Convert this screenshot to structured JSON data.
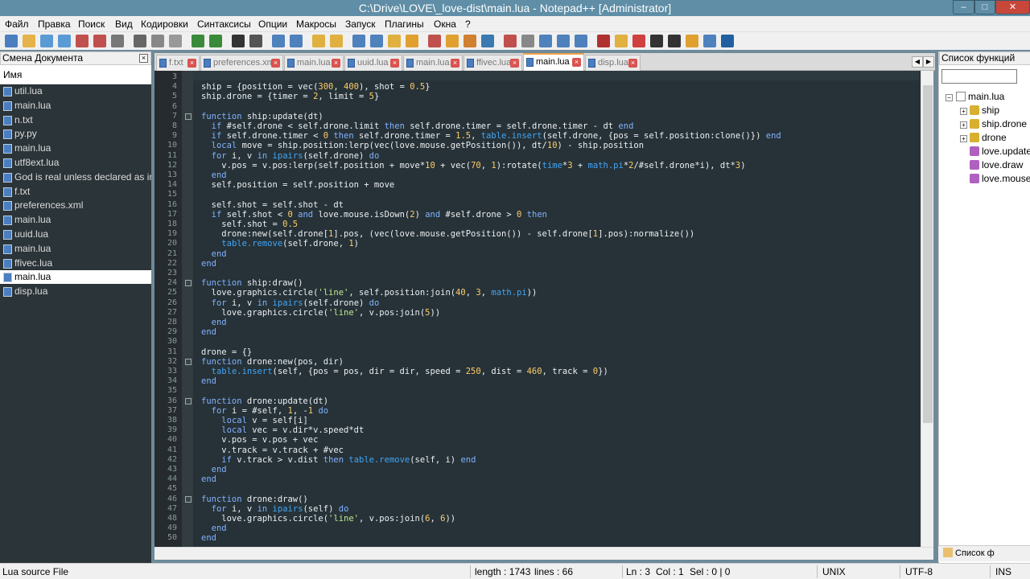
{
  "window": {
    "title": "C:\\Drive\\LOVE\\_love-dist\\main.lua - Notepad++ [Administrator]",
    "controls": {
      "minimize": "–",
      "maximize": "□",
      "close": "✕"
    }
  },
  "menu": [
    "Файл",
    "Правка",
    "Поиск",
    "Вид",
    "Кодировки",
    "Синтаксисы",
    "Опции",
    "Макросы",
    "Запуск",
    "Плагины",
    "Окна",
    "?"
  ],
  "toolbar_icons": [
    "new-file-icon",
    "open-file-icon",
    "save-icon",
    "save-all-icon",
    "close-icon",
    "close-all-icon",
    "print-icon",
    "cut-icon",
    "copy-icon",
    "paste-icon",
    "undo-icon",
    "redo-icon",
    "find-icon",
    "replace-icon",
    "zoom-in-icon",
    "zoom-out-icon",
    "sync-v-icon",
    "sync-h-icon",
    "word-wrap-icon",
    "show-all-chars-icon",
    "indent-guide-icon",
    "language-icon",
    "doc-map-icon",
    "function-list-icon",
    "folder-icon",
    "monitor-icon",
    "record-macro-icon",
    "stop-macro-icon",
    "play-macro-icon",
    "run-macro-icon",
    "save-macro-icon",
    "spellcheck-icon",
    "spell-icon",
    "heart-icon",
    "html-tag-icon",
    "text-icon",
    "explorer-icon",
    "refresh-icon",
    "globe-icon"
  ],
  "tabs": [
    {
      "label": "f.txt",
      "active": false
    },
    {
      "label": "preferences.xml",
      "active": false
    },
    {
      "label": "main.lua",
      "active": false
    },
    {
      "label": "uuid.lua",
      "active": false
    },
    {
      "label": "main.lua",
      "active": false
    },
    {
      "label": "ffivec.lua",
      "active": false
    },
    {
      "label": "main.lua",
      "active": true
    },
    {
      "label": "disp.lua",
      "active": false
    }
  ],
  "doc_switcher": {
    "title": "Смена Документа",
    "column": "Имя",
    "items": [
      "util.lua",
      "main.lua",
      "n.txt",
      "py.py",
      "main.lua",
      "utf8ext.lua",
      "God is real unless declared as int...",
      "f.txt",
      "preferences.xml",
      "main.lua",
      "uuid.lua",
      "main.lua",
      "ffivec.lua",
      "main.lua",
      "disp.lua"
    ],
    "selected_index": 13
  },
  "editor": {
    "lines": [
      {
        "n": "3",
        "text": ""
      },
      {
        "n": "4",
        "text": "ship = {position = vec(300, 400), shot = 0.5}"
      },
      {
        "n": "5",
        "text": "ship.drone = {timer = 2, limit = 5}"
      },
      {
        "n": "6",
        "text": ""
      },
      {
        "n": "7",
        "text": "function ship:update(dt)"
      },
      {
        "n": "8",
        "text": "  if #self.drone < self.drone.limit then self.drone.timer = self.drone.timer - dt end"
      },
      {
        "n": "9",
        "text": "  if self.drone.timer < 0 then self.drone.timer = 1.5, table.insert(self.drone, {pos = self.position:clone()}) end"
      },
      {
        "n": "10",
        "text": "  local move = ship.position:lerp(vec(love.mouse.getPosition()), dt/10) - ship.position"
      },
      {
        "n": "11",
        "text": "  for i, v in ipairs(self.drone) do"
      },
      {
        "n": "12",
        "text": "    v.pos = v.pos:lerp(self.position + move*10 + vec(70, 1):rotate(time*3 + math.pi*2/#self.drone*i), dt*3)"
      },
      {
        "n": "13",
        "text": "  end"
      },
      {
        "n": "14",
        "text": "  self.position = self.position + move"
      },
      {
        "n": "15",
        "text": ""
      },
      {
        "n": "16",
        "text": "  self.shot = self.shot - dt"
      },
      {
        "n": "17",
        "text": "  if self.shot < 0 and love.mouse.isDown(2) and #self.drone > 0 then"
      },
      {
        "n": "18",
        "text": "    self.shot = 0.5"
      },
      {
        "n": "19",
        "text": "    drone:new(self.drone[1].pos, (vec(love.mouse.getPosition()) - self.drone[1].pos):normalize())"
      },
      {
        "n": "20",
        "text": "    table.remove(self.drone, 1)"
      },
      {
        "n": "21",
        "text": "  end"
      },
      {
        "n": "22",
        "text": "end"
      },
      {
        "n": "23",
        "text": ""
      },
      {
        "n": "24",
        "text": "function ship:draw()"
      },
      {
        "n": "25",
        "text": "  love.graphics.circle('line', self.position:join(40, 3, math.pi))"
      },
      {
        "n": "26",
        "text": "  for i, v in ipairs(self.drone) do"
      },
      {
        "n": "27",
        "text": "    love.graphics.circle('line', v.pos:join(5))"
      },
      {
        "n": "28",
        "text": "  end"
      },
      {
        "n": "29",
        "text": "end"
      },
      {
        "n": "30",
        "text": ""
      },
      {
        "n": "31",
        "text": "drone = {}"
      },
      {
        "n": "32",
        "text": "function drone:new(pos, dir)"
      },
      {
        "n": "33",
        "text": "  table.insert(self, {pos = pos, dir = dir, speed = 250, dist = 460, track = 0})"
      },
      {
        "n": "34",
        "text": "end"
      },
      {
        "n": "35",
        "text": ""
      },
      {
        "n": "36",
        "text": "function drone:update(dt)"
      },
      {
        "n": "37",
        "text": "  for i = #self, 1, -1 do"
      },
      {
        "n": "38",
        "text": "    local v = self[i]"
      },
      {
        "n": "39",
        "text": "    local vec = v.dir*v.speed*dt"
      },
      {
        "n": "40",
        "text": "    v.pos = v.pos + vec"
      },
      {
        "n": "41",
        "text": "    v.track = v.track + #vec"
      },
      {
        "n": "42",
        "text": "    if v.track > v.dist then table.remove(self, i) end"
      },
      {
        "n": "43",
        "text": "  end"
      },
      {
        "n": "44",
        "text": "end"
      },
      {
        "n": "45",
        "text": ""
      },
      {
        "n": "46",
        "text": "function drone:draw()"
      },
      {
        "n": "47",
        "text": "  for i, v in ipairs(self) do"
      },
      {
        "n": "48",
        "text": "    love.graphics.circle('line', v.pos:join(6, 6))"
      },
      {
        "n": "49",
        "text": "  end"
      },
      {
        "n": "50",
        "text": "end"
      }
    ]
  },
  "function_list": {
    "title": "Список функций",
    "root": "main.lua",
    "items": [
      {
        "label": "ship",
        "kind": "class",
        "expandable": true
      },
      {
        "label": "ship.drone",
        "kind": "class",
        "expandable": true
      },
      {
        "label": "drone",
        "kind": "class",
        "expandable": true
      },
      {
        "label": "love.update",
        "kind": "function",
        "expandable": false
      },
      {
        "label": "love.draw",
        "kind": "function",
        "expandable": false
      },
      {
        "label": "love.mouse",
        "kind": "function",
        "expandable": false
      }
    ],
    "bottom_tab": "Список ф"
  },
  "status": {
    "filetype": "Lua source File",
    "length": "length : 1743",
    "lines": "lines : 66",
    "ln": "Ln : 3",
    "col": "Col : 1",
    "sel": "Sel : 0 | 0",
    "eol": "UNIX",
    "encoding": "UTF-8",
    "mode": "INS"
  },
  "colors": {
    "keyword": "#82b1ff",
    "number": "#ffcc66",
    "string": "#c3e88d",
    "library": "#42a5f5",
    "background": "#263238"
  }
}
